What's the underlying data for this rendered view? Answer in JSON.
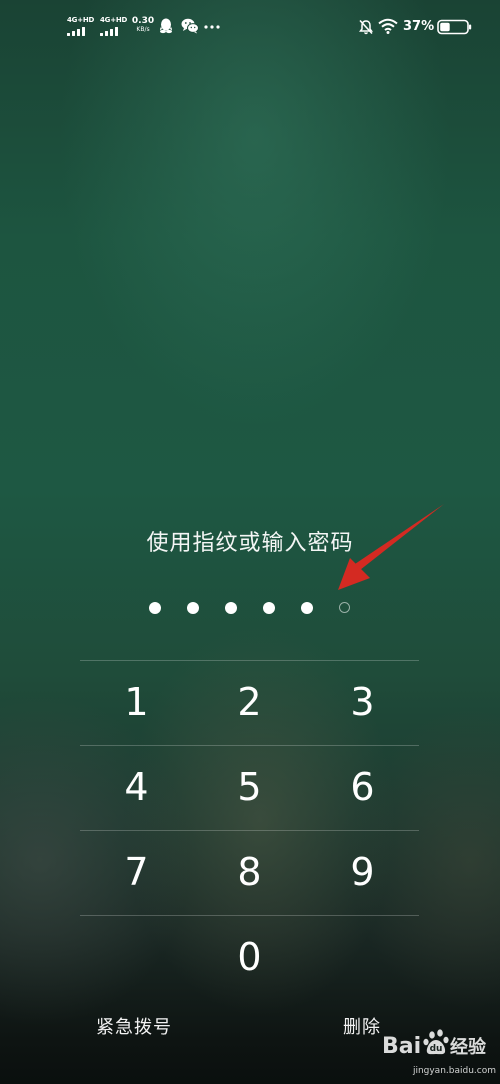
{
  "status_bar": {
    "sim1_label": "4G+HD",
    "sim2_label": "4G+HD",
    "net_speed_value": "0.30",
    "net_speed_unit": "KB/s",
    "icons": [
      "qq-icon",
      "wechat-icon",
      "more-icon",
      "mute-bell-icon",
      "wifi-icon",
      "battery-icon"
    ],
    "battery_percent": "37%",
    "battery_level": 0.37
  },
  "lock_screen": {
    "prompt": "使用指纹或输入密码",
    "pin_length": 6,
    "pin_entered": 5
  },
  "keypad": {
    "keys": [
      "1",
      "2",
      "3",
      "4",
      "5",
      "6",
      "7",
      "8",
      "9",
      "0"
    ]
  },
  "actions": {
    "emergency_label": "紧急拨号",
    "delete_label": "删除"
  },
  "annotation": {
    "arrow_color": "#d42a22"
  },
  "watermark": {
    "logo_text": "Bai经验",
    "domain": "jingyan.baidu.com"
  }
}
